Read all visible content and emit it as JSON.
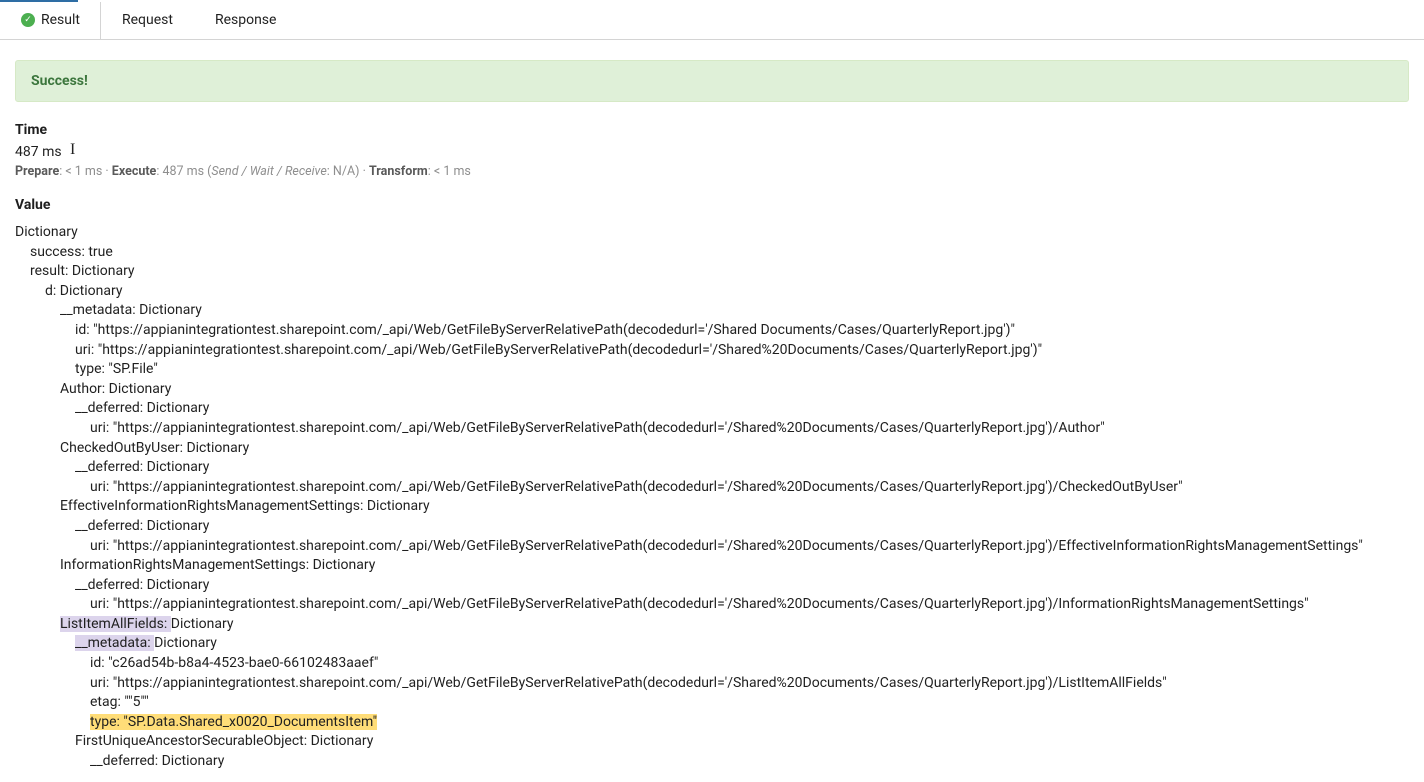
{
  "tabs": {
    "result": "Result",
    "request": "Request",
    "response": "Response"
  },
  "success_banner": "Success!",
  "time": {
    "header": "Time",
    "value": "487 ms",
    "prepare_label": "Prepare",
    "prepare_val": ": < 1 ms · ",
    "execute_label": "Execute",
    "execute_val": ": 487 ms (",
    "swr": "Send / Wait / Receive",
    "swr_val": ": N/A) · ",
    "transform_label": "Transform",
    "transform_val": ": < 1 ms"
  },
  "value_header": "Value",
  "tree": [
    {
      "i": 0,
      "t": "Dictionary"
    },
    {
      "i": 1,
      "t": "success: true"
    },
    {
      "i": 1,
      "t": "result: Dictionary"
    },
    {
      "i": 2,
      "t": "d: Dictionary"
    },
    {
      "i": 3,
      "t": "__metadata: Dictionary"
    },
    {
      "i": 4,
      "t": "id: \"https://appianintegrationtest.sharepoint.com/_api/Web/GetFileByServerRelativePath(decodedurl='/Shared Documents/Cases/QuarterlyReport.jpg')\""
    },
    {
      "i": 4,
      "t": "uri: \"https://appianintegrationtest.sharepoint.com/_api/Web/GetFileByServerRelativePath(decodedurl='/Shared%20Documents/Cases/QuarterlyReport.jpg')\""
    },
    {
      "i": 4,
      "t": "type: \"SP.File\""
    },
    {
      "i": 3,
      "t": "Author: Dictionary"
    },
    {
      "i": 4,
      "t": "__deferred: Dictionary"
    },
    {
      "i": 5,
      "t": "uri: \"https://appianintegrationtest.sharepoint.com/_api/Web/GetFileByServerRelativePath(decodedurl='/Shared%20Documents/Cases/QuarterlyReport.jpg')/Author\""
    },
    {
      "i": 3,
      "t": "CheckedOutByUser: Dictionary"
    },
    {
      "i": 4,
      "t": "__deferred: Dictionary"
    },
    {
      "i": 5,
      "t": "uri: \"https://appianintegrationtest.sharepoint.com/_api/Web/GetFileByServerRelativePath(decodedurl='/Shared%20Documents/Cases/QuarterlyReport.jpg')/CheckedOutByUser\""
    },
    {
      "i": 3,
      "t": "EffectiveInformationRightsManagementSettings: Dictionary"
    },
    {
      "i": 4,
      "t": "__deferred: Dictionary"
    },
    {
      "i": 5,
      "t": "uri: \"https://appianintegrationtest.sharepoint.com/_api/Web/GetFileByServerRelativePath(decodedurl='/Shared%20Documents/Cases/QuarterlyReport.jpg')/EffectiveInformationRightsManagementSettings\""
    },
    {
      "i": 3,
      "t": "InformationRightsManagementSettings: Dictionary"
    },
    {
      "i": 4,
      "t": "__deferred: Dictionary"
    },
    {
      "i": 5,
      "t": "uri: \"https://appianintegrationtest.sharepoint.com/_api/Web/GetFileByServerRelativePath(decodedurl='/Shared%20Documents/Cases/QuarterlyReport.jpg')/InformationRightsManagementSettings\""
    },
    {
      "i": 3,
      "hl": "purple",
      "t": "ListItemAllFields: ",
      "tail": "Dictionary"
    },
    {
      "i": 4,
      "hl": "purple",
      "t": "__metadata: ",
      "tail": "Dictionary"
    },
    {
      "i": 5,
      "t": "id: \"c26ad54b-b8a4-4523-bae0-66102483aaef\""
    },
    {
      "i": 5,
      "t": "uri: \"https://appianintegrationtest.sharepoint.com/_api/Web/GetFileByServerRelativePath(decodedurl='/Shared%20Documents/Cases/QuarterlyReport.jpg')/ListItemAllFields\""
    },
    {
      "i": 5,
      "t": "etag: \"\"5\"\""
    },
    {
      "i": 5,
      "hl": "yellow",
      "t": "type: \"SP.Data.Shared_x0020_DocumentsItem\""
    },
    {
      "i": 4,
      "t": "FirstUniqueAncestorSecurableObject: Dictionary"
    },
    {
      "i": 5,
      "t": "__deferred: Dictionary"
    }
  ]
}
